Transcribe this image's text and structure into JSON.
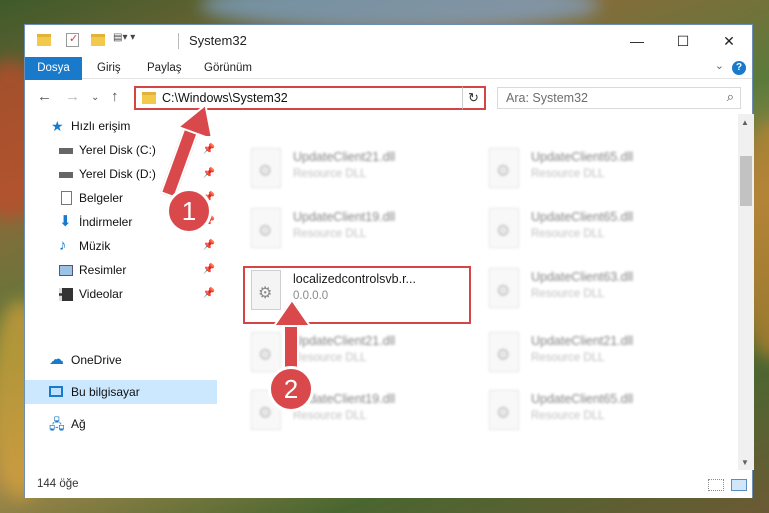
{
  "window": {
    "title": "System32",
    "controls": {
      "minimize": "—",
      "maximize": "☐",
      "close": "✕"
    }
  },
  "ribbon": {
    "tabs": [
      "Dosya",
      "Giriş",
      "Paylaş",
      "Görünüm"
    ],
    "help": "?"
  },
  "nav": {
    "address": "C:\\Windows\\System32",
    "search_placeholder": "Ara: System32"
  },
  "sidebar": {
    "quick_access": "Hızlı erişim",
    "items": [
      {
        "label": "Yerel Disk (C:)",
        "icon": "drive-icon",
        "pinned": true
      },
      {
        "label": "Yerel Disk (D:)",
        "icon": "drive-icon",
        "pinned": true
      },
      {
        "label": "Belgeler",
        "icon": "documents-icon",
        "pinned": true
      },
      {
        "label": "İndirmeler",
        "icon": "downloads-icon",
        "pinned": true
      },
      {
        "label": "Müzik",
        "icon": "music-icon",
        "pinned": true
      },
      {
        "label": "Resimler",
        "icon": "pictures-icon",
        "pinned": true
      },
      {
        "label": "Videolar",
        "icon": "videos-icon",
        "pinned": true
      }
    ],
    "onedrive": "OneDrive",
    "this_pc": "Bu bilgisayar",
    "network": "Ağ"
  },
  "files": [
    {
      "name": "UpdateClient21.dll",
      "type": "Resource DLL"
    },
    {
      "name": "UpdateClient65.dll",
      "type": "Resource DLL"
    },
    {
      "name": "UpdateClient19.dll",
      "type": "Resource DLL"
    },
    {
      "name": "UpdateClient65.dll",
      "type": "Resource DLL"
    },
    {
      "name": "localizedcontrolsvb.r...",
      "type": "0.0.0.0"
    },
    {
      "name": "UpdateClient63.dll",
      "type": "Resource DLL"
    },
    {
      "name": "UpdateClient21.dll",
      "type": "Resource DLL"
    },
    {
      "name": "UpdateClient21.dll",
      "type": "Resource DLL"
    },
    {
      "name": "UpdateClient19.dll",
      "type": "Resource DLL"
    },
    {
      "name": "UpdateClient65.dll",
      "type": "Resource DLL"
    }
  ],
  "status": {
    "count": "144 öğe"
  },
  "callouts": {
    "one": "1",
    "two": "2"
  },
  "colors": {
    "accent": "#1979ca",
    "highlight": "#d64545",
    "selected": "#cce8ff"
  }
}
